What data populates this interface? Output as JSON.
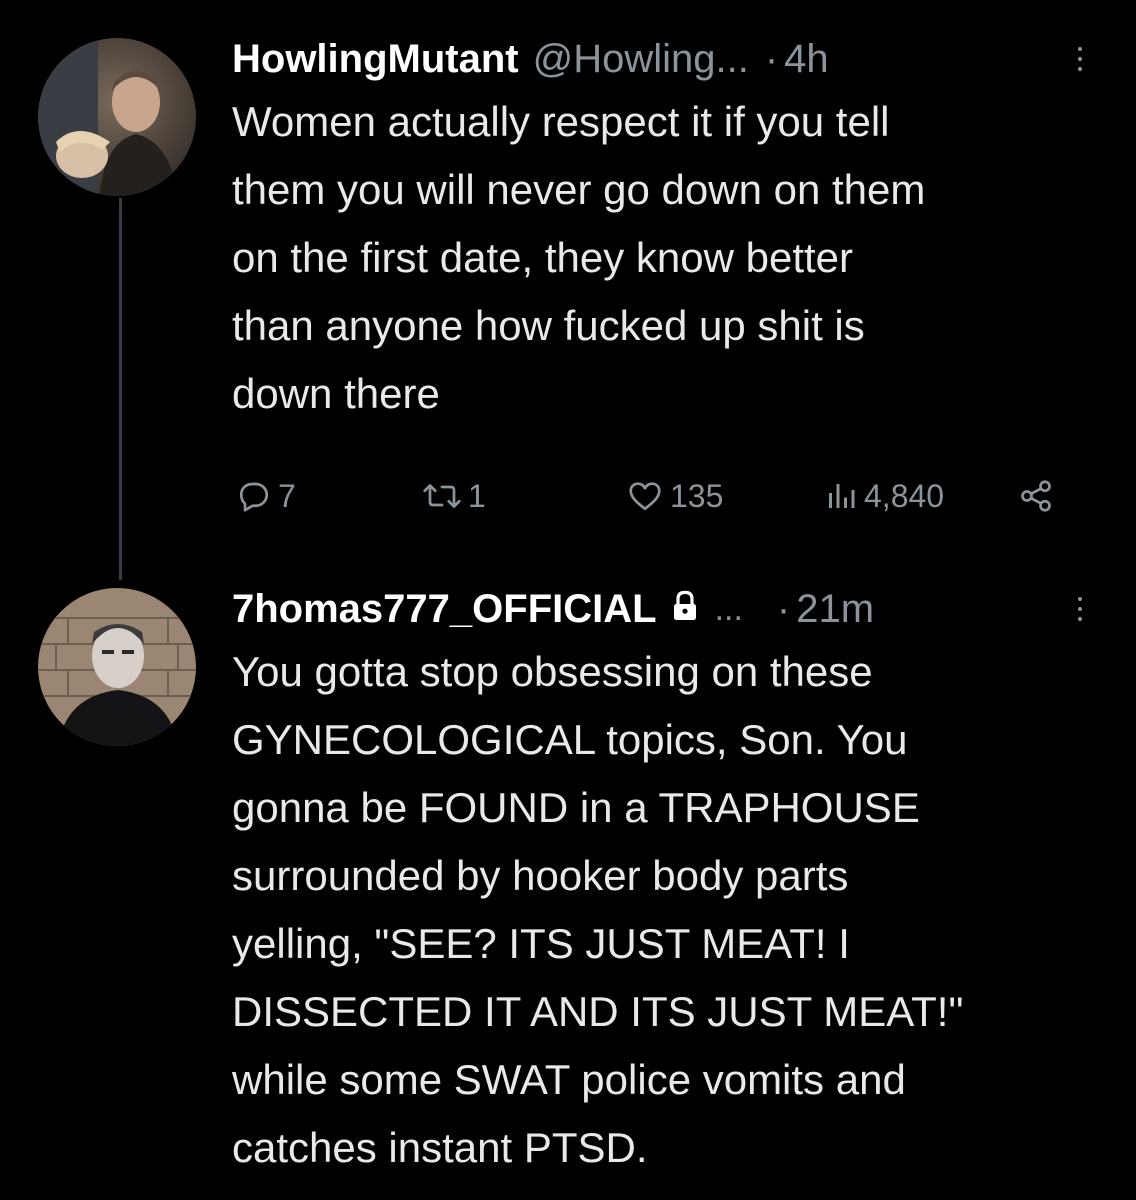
{
  "tweets": [
    {
      "author": {
        "name": "HowlingMutant",
        "handle": "@Howling...",
        "time": "4h",
        "verified_lock": false,
        "avatar_icon": "avatar-photo"
      },
      "text": "Women actually respect it if you tell\nthem you will never go down on them\non the first date, they know better\nthan anyone how fucked up shit is\ndown there",
      "stats": {
        "replies": "7",
        "retweets": "1",
        "likes": "135",
        "views": "4,840"
      }
    },
    {
      "author": {
        "name": "7homas777_OFFICIAL",
        "handle": "...",
        "time": "21m",
        "verified_lock": true,
        "avatar_icon": "avatar-photo"
      },
      "text": "You gotta stop obsessing on these\nGYNECOLOGICAL topics, Son. You\ngonna be FOUND in a TRAPHOUSE\nsurrounded by hooker body parts\nyelling, \"SEE? ITS JUST MEAT! I\nDISSECTED IT AND ITS JUST MEAT!\"\nwhile some SWAT police vomits and\ncatches instant PTSD."
    }
  ],
  "separators": {
    "dot": "·"
  },
  "colors": {
    "background": "#000000",
    "text": "#e7e9ea",
    "muted": "#8b949b",
    "thread_line": "#3a3d41"
  }
}
